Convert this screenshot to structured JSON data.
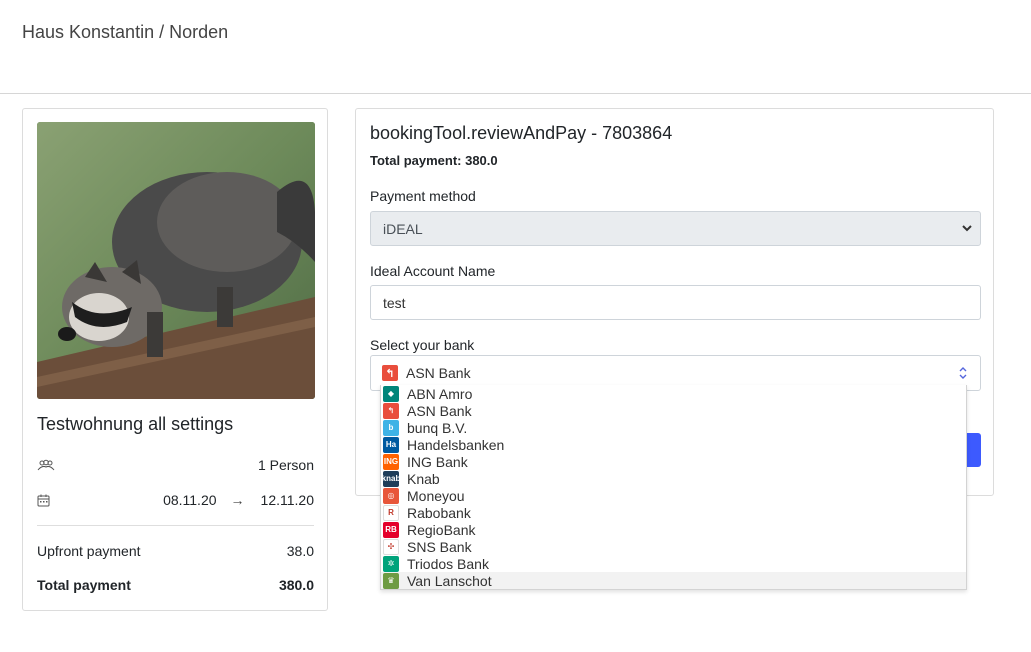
{
  "header": {
    "title": "Haus Konstantin / Norden"
  },
  "summary": {
    "apartment_name": "Testwohnung all settings",
    "guests": "1 Person",
    "date_from": "08.11.20",
    "date_arrow": "→",
    "date_to": "12.11.20",
    "upfront_label": "Upfront payment",
    "upfront_value": "38.0",
    "total_label": "Total payment",
    "total_value": "380.0"
  },
  "review": {
    "title": "bookingTool.reviewAndPay - 7803864",
    "total_line": "Total payment: 380.0",
    "payment_method_label": "Payment method",
    "payment_method_value": "iDEAL",
    "account_name_label": "Ideal Account Name",
    "account_name_value": "test",
    "bank_label": "Select your bank",
    "bank_selected": "ASN Bank"
  },
  "banks": [
    {
      "name": "ABN Amro",
      "color": "#00857a",
      "glyph": "◆"
    },
    {
      "name": "ASN Bank",
      "color": "#e94e3c",
      "glyph": "↰"
    },
    {
      "name": "bunq B.V.",
      "color": "#3eb3e6",
      "glyph": "b"
    },
    {
      "name": "Handelsbanken",
      "color": "#005aa0",
      "glyph": "Ha"
    },
    {
      "name": "ING Bank",
      "color": "#ff6200",
      "glyph": "ING"
    },
    {
      "name": "Knab",
      "color": "#1e3d59",
      "glyph": "knab"
    },
    {
      "name": "Moneyou",
      "color": "#e8563a",
      "glyph": "◎"
    },
    {
      "name": "Rabobank",
      "color": "#ffffff",
      "glyph": "R"
    },
    {
      "name": "RegioBank",
      "color": "#e4002b",
      "glyph": "RB"
    },
    {
      "name": "SNS Bank",
      "color": "#ffffff",
      "glyph": "✣"
    },
    {
      "name": "Triodos Bank",
      "color": "#00a37b",
      "glyph": "✲"
    },
    {
      "name": "Van Lanschot",
      "color": "#6e9b43",
      "glyph": "♛"
    }
  ],
  "colors": {
    "accent": "#3d5afe",
    "border": "#dcdcdc"
  },
  "icons": {
    "guests": "users-icon",
    "dates": "calendar-icon"
  }
}
